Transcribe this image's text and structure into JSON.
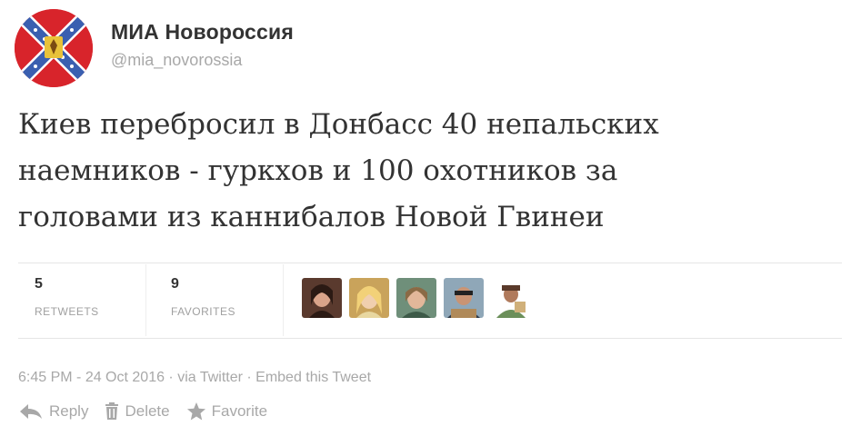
{
  "user": {
    "display_name": "МИА Новороссия",
    "screen_name": "@mia_novorossia",
    "avatar_icon": "novorossia-flag-avatar"
  },
  "tweet": {
    "lines": [
      "Киев перебросил в Донбасс 40 непальских",
      "наемников - гуркхов и 100 охотников за",
      "головами из каннибалов Новой Гвинеи"
    ]
  },
  "stats": {
    "retweets_count": "5",
    "retweets_label": "RETWEETS",
    "favorites_count": "9",
    "favorites_label": "FAVORITES"
  },
  "meta": {
    "time": "6:45 PM",
    "sep1": " - ",
    "date": "24 Oct 2016",
    "sep2": " · ",
    "via": "via Twitter",
    "sep3": " · ",
    "embed": "Embed this Tweet"
  },
  "actions": {
    "reply": "Reply",
    "delete": "Delete",
    "favorite": "Favorite"
  },
  "colors": {
    "avatar_red": "#d8242b",
    "avatar_blue": "#3a5fb0",
    "muted_text": "#a8a8a8"
  }
}
